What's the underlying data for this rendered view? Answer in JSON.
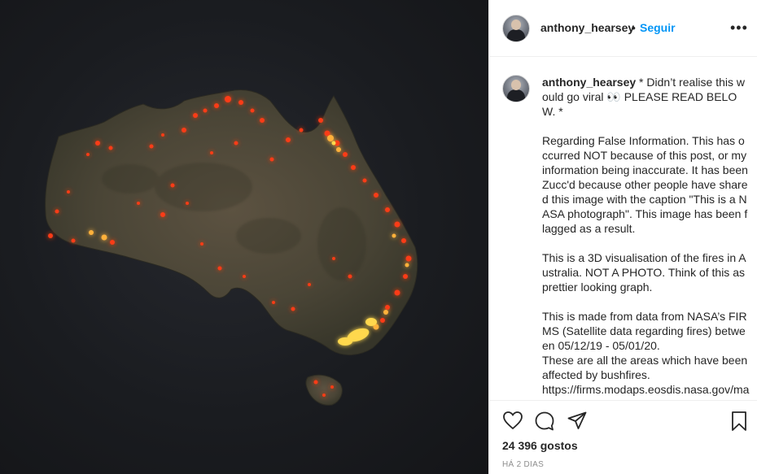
{
  "post": {
    "username": "anthony_hearsey",
    "follow_label": "Seguir",
    "separator": "•",
    "more_label": "•••"
  },
  "caption": {
    "username": "anthony_hearsey",
    "text": " * Didn’t realise this would go viral 👀 PLEASE READ BELOW. *\n\nRegarding False Information. This has occurred NOT because of this post, or my information being inaccurate. It has been Zucc'd because other people have shared this image with the caption \"This is a NASA photograph\". This image has been flagged as a result.\n\nThis is a 3D visualisation of the fires in Australia. NOT A PHOTO. Think of this as prettier looking graph.\n\nThis is made from data from NASA’s FIRMS (Satellite data regarding fires) between 05/12/19 - 05/01/20.\nThese are all the areas which have been affected by bushfires.\nhttps://firms.modaps.eosdis.nasa.gov/map"
  },
  "actions": {
    "likes": "24 396 gostos",
    "timestamp": "HÁ 2 DIAS"
  },
  "icons": {
    "like": "heart-icon",
    "comment": "comment-icon",
    "share": "paper-plane-icon",
    "save": "bookmark-icon",
    "more": "more-dots-icon"
  },
  "colors": {
    "accent": "#0095f6",
    "text": "#262626",
    "muted": "#8e8e8e",
    "fire": "#ff4a1c",
    "fire_hot": "#ffd24a",
    "background_image": "#1a1c20"
  }
}
